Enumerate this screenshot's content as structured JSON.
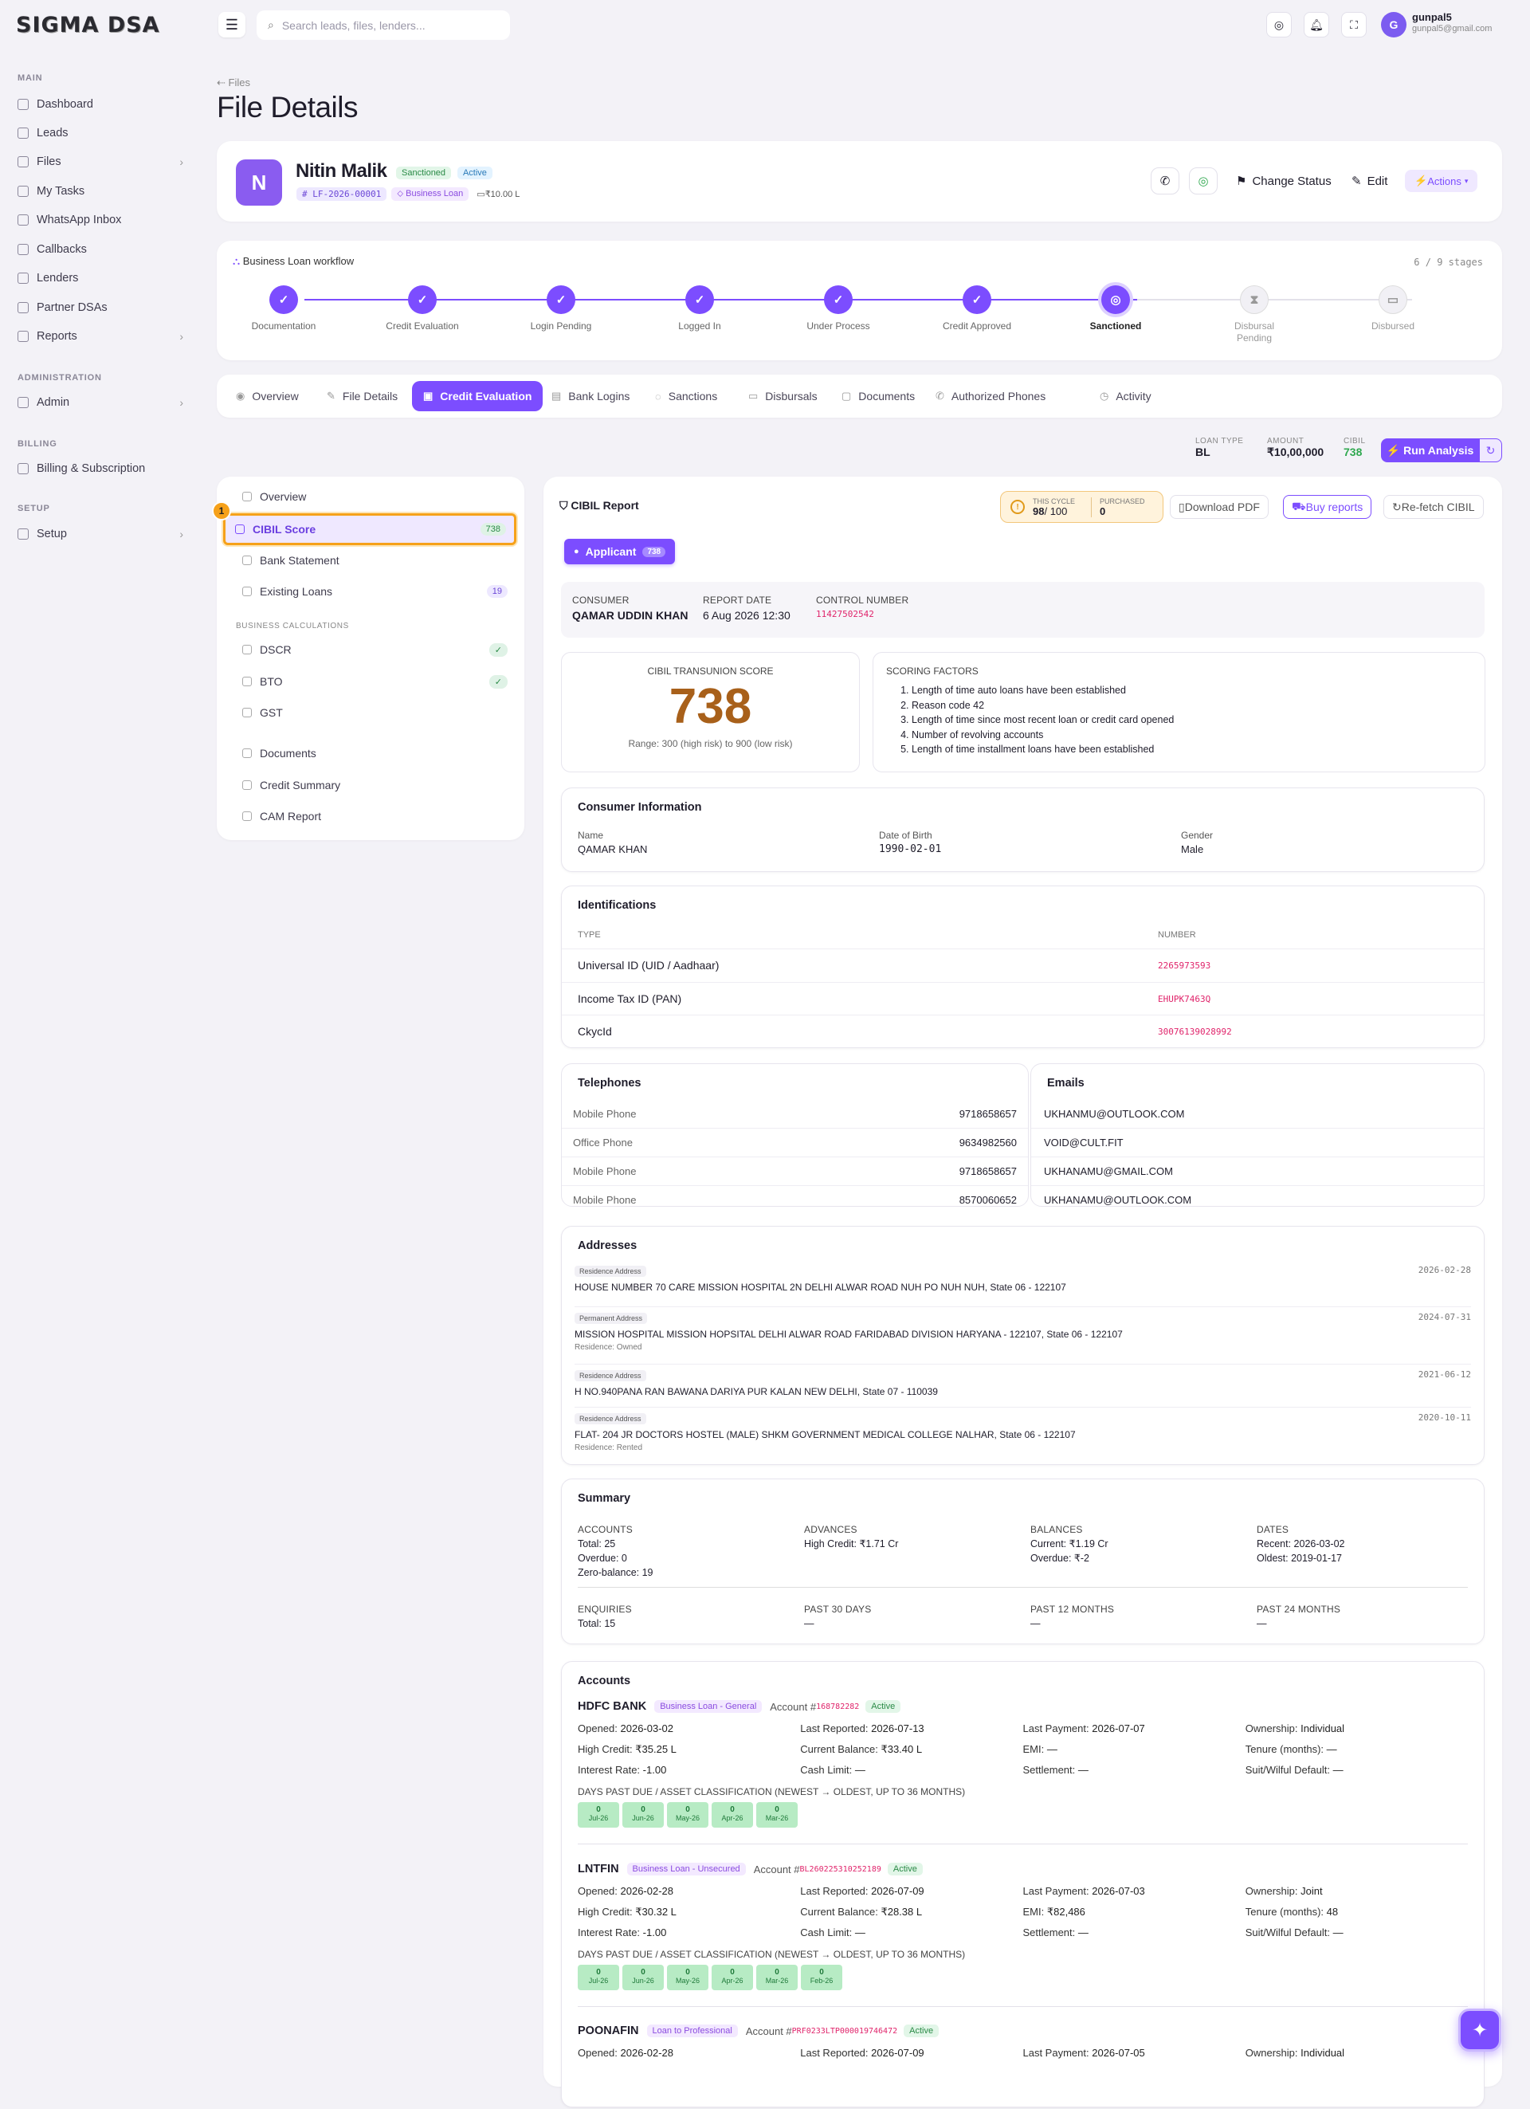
{
  "brand": {
    "logo": "SIGMA DSA"
  },
  "sidebar": {
    "sections": [
      {
        "label": "MAIN"
      },
      {
        "label": "ADMINISTRATION"
      },
      {
        "label": "BILLING"
      },
      {
        "label": "SETUP"
      }
    ],
    "items": [
      {
        "label": "Dashboard",
        "icon": "home-icon"
      },
      {
        "label": "Leads",
        "icon": "users-icon"
      },
      {
        "label": "Files",
        "icon": "folder-icon"
      },
      {
        "label": "My Tasks",
        "icon": "checklist-icon"
      },
      {
        "label": "WhatsApp Inbox",
        "icon": "chat-icon"
      },
      {
        "label": "Callbacks",
        "icon": "phone-icon"
      },
      {
        "label": "Lenders",
        "icon": "bank-icon"
      },
      {
        "label": "Partner DSAs",
        "icon": "handshake-icon"
      },
      {
        "label": "Reports",
        "icon": "chart-icon"
      },
      {
        "label": "Admin",
        "icon": "gear-icon"
      },
      {
        "label": "Billing & Subscription",
        "icon": "card-icon"
      },
      {
        "label": "Setup",
        "icon": "wrench-icon"
      }
    ]
  },
  "topbar": {
    "search_placeholder": "Search leads, files, lenders...",
    "user": {
      "initial": "G",
      "name": "gunpal5",
      "email": "gunpal5@gmail.com"
    }
  },
  "page": {
    "breadcrumb": "Files",
    "title": "File Details"
  },
  "file": {
    "initial": "N",
    "name": "Nitin Malik",
    "status1": "Sanctioned",
    "status2": "Active",
    "id": "LF-2026-00001",
    "product": "Business Loan",
    "amount": "₹10.00 L",
    "actions": {
      "change_status": "Change Status",
      "edit": "Edit",
      "actions": "Actions"
    }
  },
  "workflow": {
    "title": "Business Loan workflow",
    "progress": "6 / 9 stages",
    "stages": [
      "Documentation",
      "Credit Evaluation",
      "Login Pending",
      "Logged In",
      "Under Process",
      "Credit Approved",
      "Sanctioned",
      "Disbursal Pending",
      "Disbursed"
    ]
  },
  "tabs": [
    "Overview",
    "File Details",
    "Credit Evaluation",
    "Bank Logins",
    "Sanctions",
    "Disbursals",
    "Documents",
    "Authorized Phones",
    "Activity"
  ],
  "summary_bar": {
    "loan_type_label": "LOAN TYPE",
    "loan_type": "BL",
    "amount_label": "AMOUNT",
    "amount": "₹10,00,000",
    "cibil_label": "CIBIL",
    "cibil": "738",
    "run": "Run Analysis"
  },
  "left_nav": {
    "items": [
      "Overview",
      "CIBIL Score",
      "Bank Statement",
      "Existing Loans"
    ],
    "cibil_badge": "738",
    "loans_badge": "19",
    "calc_header": "BUSINESS CALCULATIONS",
    "calc": [
      "DSCR",
      "BTO",
      "GST"
    ],
    "more": [
      "Documents",
      "Credit Summary",
      "CAM Report"
    ],
    "marker": "1"
  },
  "report": {
    "title": "CIBIL Report",
    "cycle_label": "THIS CYCLE",
    "cycle_used": "98",
    "cycle_total": "/ 100",
    "purchased_label": "PURCHASED",
    "purchased": "0",
    "download": "Download PDF",
    "buy": "Buy reports",
    "refetch": "Re-fetch CIBIL",
    "applicant": "Applicant",
    "applicant_score": "738",
    "consumer_label": "CONSUMER",
    "consumer": "QAMAR UDDIN KHAN",
    "report_date_label": "REPORT DATE",
    "report_date": "6 Aug 2026 12:30",
    "control_label": "CONTROL NUMBER",
    "control": "11427502542",
    "score_label": "CIBIL TRANSUNION SCORE",
    "score": "738",
    "score_range": "Range: 300 (high risk) to 900 (low risk)",
    "factors_label": "SCORING FACTORS",
    "factors": [
      "Length of time auto loans have been established",
      "Reason code 42",
      "Length of time since most recent loan or credit card opened",
      "Number of revolving accounts",
      "Length of time installment loans have been established"
    ]
  },
  "consumer_info": {
    "title": "Consumer Information",
    "name_label": "Name",
    "name": "QAMAR KHAN",
    "dob_label": "Date of Birth",
    "dob": "1990-02-01",
    "gender_label": "Gender",
    "gender": "Male"
  },
  "identifications": {
    "title": "Identifications",
    "type_label": "TYPE",
    "number_label": "NUMBER",
    "rows": [
      {
        "type": "Universal ID (UID / Aadhaar)",
        "number": "2265973593"
      },
      {
        "type": "Income Tax ID (PAN)",
        "number": "EHUPK7463Q"
      },
      {
        "type": "CkycId",
        "number": "30076139028992"
      }
    ]
  },
  "telephones": {
    "title": "Telephones",
    "rows": [
      {
        "type": "Mobile Phone",
        "number": "9718658657"
      },
      {
        "type": "Office Phone",
        "number": "9634982560"
      },
      {
        "type": "Mobile Phone",
        "number": "9718658657"
      },
      {
        "type": "Mobile Phone",
        "number": "8570060652"
      }
    ]
  },
  "emails": {
    "title": "Emails",
    "rows": [
      "UKHANMU@OUTLOOK.COM",
      "VOID@CULT.FIT",
      "UKHANAMU@GMAIL.COM",
      "UKHANAMU@OUTLOOK.COM"
    ]
  },
  "addresses": {
    "title": "Addresses",
    "rows": [
      {
        "tag": "Residence Address",
        "text": "HOUSE NUMBER 70 CARE MISSION HOSPITAL 2N DELHI ALWAR ROAD NUH PO NUH NUH, State 06 - 122107",
        "date": "2026-02-28",
        "note": ""
      },
      {
        "tag": "Permanent Address",
        "text": "MISSION HOSPITAL MISSION HOPSITAL DELHI ALWAR ROAD FARIDABAD DIVISION HARYANA - 122107, State 06 - 122107",
        "date": "2024-07-31",
        "note": "Residence: Owned"
      },
      {
        "tag": "Residence Address",
        "text": "H NO.940PANA RAN BAWANA DARIYA PUR KALAN NEW DELHI, State 07 - 110039",
        "date": "2021-06-12",
        "note": ""
      },
      {
        "tag": "Residence Address",
        "text": "FLAT- 204 JR DOCTORS HOSTEL (MALE) SHKM GOVERNMENT MEDICAL COLLEGE NALHAR, State 06 - 122107",
        "date": "2020-10-11",
        "note": "Residence: Rented"
      }
    ]
  },
  "summary": {
    "title": "Summary",
    "accounts_label": "ACCOUNTS",
    "accounts": [
      "Total: 25",
      "Overdue: 0",
      "Zero-balance: 19"
    ],
    "advances_label": "ADVANCES",
    "advances": [
      "High Credit: ₹1.71 Cr"
    ],
    "balances_label": "BALANCES",
    "balances": [
      "Current: ₹1.19 Cr",
      "Overdue: ₹-2"
    ],
    "dates_label": "DATES",
    "dates": [
      "Recent: 2026-03-02",
      "Oldest: 2019-01-17"
    ],
    "enquiries_label": "ENQUIRIES",
    "enquiries": "Total: 15",
    "p30_label": "PAST 30 DAYS",
    "p30": "—",
    "p12_label": "PAST 12 MONTHS",
    "p12": "—",
    "p24_label": "PAST 24 MONTHS",
    "p24": "—"
  },
  "accounts": {
    "title": "Accounts",
    "dpd_label": "DAYS PAST DUE / ASSET CLASSIFICATION (NEWEST → OLDEST, UP TO 36 MONTHS)",
    "list": [
      {
        "bank": "HDFC BANK",
        "type": "Business Loan - General",
        "acc_prefix": "Account #",
        "acc": "168782282",
        "status": "Active",
        "opened": "2026-03-02",
        "last_reported": "2026-07-13",
        "last_payment": "2026-07-07",
        "ownership": "Individual",
        "high_credit": "₹35.25 L",
        "current_balance": "₹33.40 L",
        "emi": "—",
        "tenure": "—",
        "interest": "-1.00",
        "cash_limit": "—",
        "settlement": "—",
        "suit": "—",
        "dpd": [
          [
            "0",
            "Jul-26"
          ],
          [
            "0",
            "Jun-26"
          ],
          [
            "0",
            "May-26"
          ],
          [
            "0",
            "Apr-26"
          ],
          [
            "0",
            "Mar-26"
          ]
        ]
      },
      {
        "bank": "LNTFIN",
        "type": "Business Loan - Unsecured",
        "acc_prefix": "Account #",
        "acc": "BL260225310252189",
        "status": "Active",
        "opened": "2026-02-28",
        "last_reported": "2026-07-09",
        "last_payment": "2026-07-03",
        "ownership": "Joint",
        "high_credit": "₹30.32 L",
        "current_balance": "₹28.38 L",
        "emi": "₹82,486",
        "tenure": "48",
        "interest": "-1.00",
        "cash_limit": "—",
        "settlement": "—",
        "suit": "—",
        "dpd": [
          [
            "0",
            "Jul-26"
          ],
          [
            "0",
            "Jun-26"
          ],
          [
            "0",
            "May-26"
          ],
          [
            "0",
            "Apr-26"
          ],
          [
            "0",
            "Mar-26"
          ],
          [
            "0",
            "Feb-26"
          ]
        ]
      },
      {
        "bank": "POONAFIN",
        "type": "Loan to Professional",
        "acc_prefix": "Account #",
        "acc": "PRF0233LTP000019746472",
        "status": "Active",
        "opened": "2026-02-28",
        "last_reported": "2026-07-09",
        "last_payment": "2026-07-05",
        "ownership": "Individual"
      }
    ],
    "labels": {
      "opened": "Opened:",
      "last_reported": "Last Reported:",
      "last_payment": "Last Payment:",
      "ownership": "Ownership:",
      "high_credit": "High Credit:",
      "current_balance": "Current Balance:",
      "emi": "EMI:",
      "tenure": "Tenure (months):",
      "interest": "Interest Rate:",
      "cash_limit": "Cash Limit:",
      "settlement": "Settlement:",
      "suit": "Suit/Wilful Default:"
    }
  },
  "colors": {
    "accent": "#7c4dff",
    "success": "#2fa84f",
    "score": "#a8601a"
  }
}
